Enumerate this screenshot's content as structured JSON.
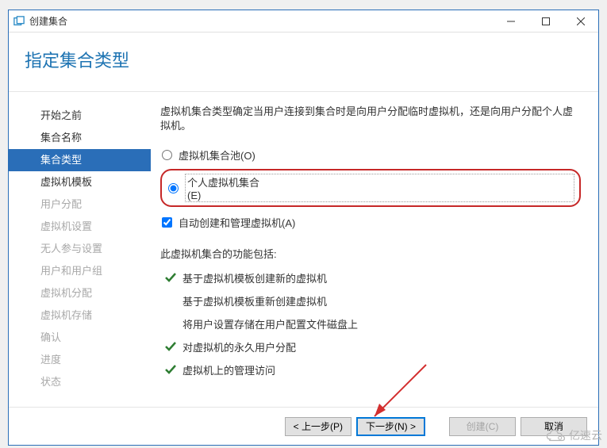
{
  "window": {
    "title": "创建集合"
  },
  "header": {
    "title": "指定集合类型"
  },
  "sidebar": {
    "items": [
      {
        "label": "开始之前",
        "state": "normal"
      },
      {
        "label": "集合名称",
        "state": "normal"
      },
      {
        "label": "集合类型",
        "state": "active"
      },
      {
        "label": "虚拟机模板",
        "state": "normal"
      },
      {
        "label": "用户分配",
        "state": "disabled"
      },
      {
        "label": "虚拟机设置",
        "state": "disabled"
      },
      {
        "label": "无人参与设置",
        "state": "disabled"
      },
      {
        "label": "用户和用户组",
        "state": "disabled"
      },
      {
        "label": "虚拟机分配",
        "state": "disabled"
      },
      {
        "label": "虚拟机存储",
        "state": "disabled"
      },
      {
        "label": "确认",
        "state": "disabled"
      },
      {
        "label": "进度",
        "state": "disabled"
      },
      {
        "label": "状态",
        "state": "disabled"
      }
    ]
  },
  "content": {
    "description": "虚拟机集合类型确定当用户连接到集合时是向用户分配临时虚拟机，还是向用户分配个人虚拟机。",
    "radio_pool": "虚拟机集合池(O)",
    "radio_personal": "个人虚拟机集合(E)",
    "checkbox_auto": "自动创建和管理虚拟机(A)",
    "features_title": "此虚拟机集合的功能包括:",
    "features": [
      {
        "text": "基于虚拟机模板创建新的虚拟机",
        "check": true
      },
      {
        "text": "基于虚拟机模板重新创建虚拟机",
        "check": false
      },
      {
        "text": "将用户设置存储在用户配置文件磁盘上",
        "check": false
      },
      {
        "text": "对虚拟机的永久用户分配",
        "check": true
      },
      {
        "text": "虚拟机上的管理访问",
        "check": true
      }
    ]
  },
  "footer": {
    "prev": "< 上一步(P)",
    "next": "下一步(N) >",
    "create": "创建(C)",
    "cancel": "取消"
  },
  "watermark": {
    "text": "亿速云"
  }
}
